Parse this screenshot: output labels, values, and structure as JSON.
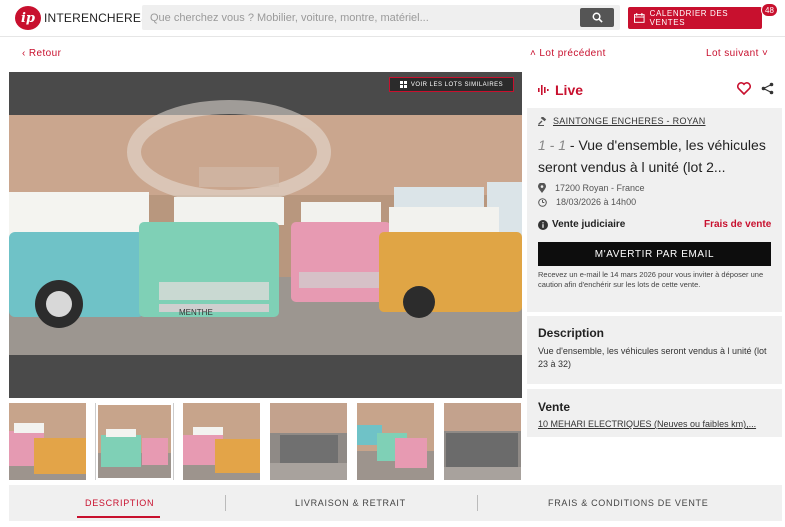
{
  "header": {
    "logo_mark": "ip",
    "logo_text": "INTERENCHERES",
    "search_placeholder": "Que cherchez vous ? Mobilier, voiture, montre, matériel...",
    "calendar_label": "CALENDRIER DES VENTES",
    "calendar_badge": "48"
  },
  "nav": {
    "back": "‹ Retour",
    "prev": "˄ Lot précédent",
    "next": "Lot suivant ˅"
  },
  "gallery": {
    "similar_label": "VOIR LES LOTS SIMILAIRES",
    "plate_text": "MENTHE"
  },
  "lot": {
    "live_label": "Live",
    "seller": "SAINTONGE ENCHERES - ROYAN",
    "lot_number": "1 - 1",
    "title": " - Vue d'ensemble, les véhicules seront vendus à l unité (lot 2...",
    "location": "17200 Royan - France",
    "datetime": "18/03/2026 à 14h00",
    "sale_type": "Vente judiciaire",
    "fees_link": "Frais de vente",
    "alert_button": "M'AVERTIR PAR EMAIL",
    "alert_note": "Recevez un e-mail le 14 mars 2026 pour vous inviter à déposer une caution afin d'enchérir sur les lots de cette vente."
  },
  "description": {
    "heading": "Description",
    "text": "Vue d'ensemble, les véhicules seront vendus à l unité (lot 23 à 32)"
  },
  "vente": {
    "heading": "Vente",
    "link": "10 MEHARI ELECTRIQUES (Neuves ou faibles km),..."
  },
  "tabs": {
    "description": "DESCRIPTION",
    "livraison": "LIVRAISON & RETRAIT",
    "frais": "FRAIS & CONDITIONS DE VENTE"
  },
  "colors": {
    "accent": "#c8102e",
    "panel": "#f0f0f0"
  }
}
